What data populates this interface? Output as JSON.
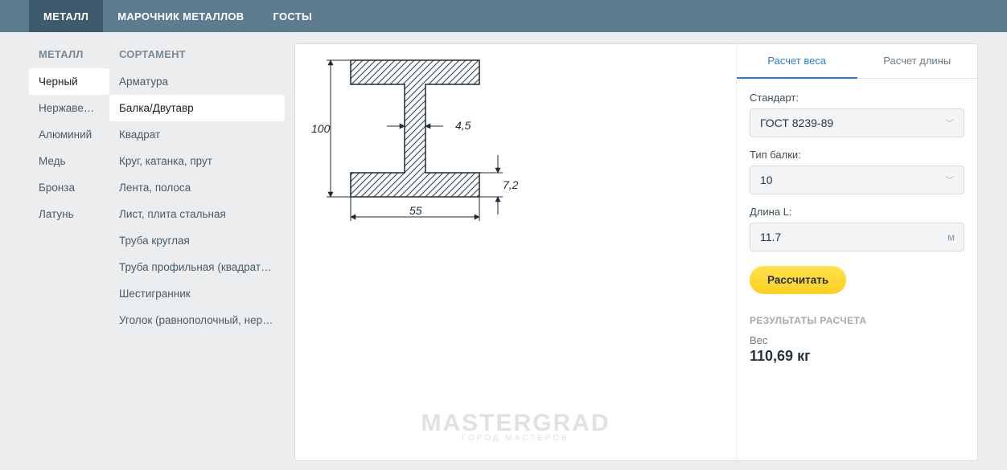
{
  "topNav": {
    "items": [
      {
        "label": "МЕТАЛЛ",
        "active": true
      },
      {
        "label": "МАРОЧНИК МЕТАЛЛОВ",
        "active": false
      },
      {
        "label": "ГОСТЫ",
        "active": false
      }
    ]
  },
  "sidebarMetal": {
    "header": "МЕТАЛЛ",
    "items": [
      {
        "label": "Черный",
        "active": true
      },
      {
        "label": "Нержавейка"
      },
      {
        "label": "Алюминий"
      },
      {
        "label": "Медь"
      },
      {
        "label": "Бронза"
      },
      {
        "label": "Латунь"
      }
    ]
  },
  "sidebarSortament": {
    "header": "СОРТАМЕНТ",
    "items": [
      {
        "label": "Арматура"
      },
      {
        "label": "Балка/Двутавр",
        "active": true
      },
      {
        "label": "Квадрат"
      },
      {
        "label": "Круг, катанка, прут"
      },
      {
        "label": "Лента, полоса"
      },
      {
        "label": "Лист, плита стальная"
      },
      {
        "label": "Труба круглая"
      },
      {
        "label": "Труба профильная (квадратная /…"
      },
      {
        "label": "Шестигранник"
      },
      {
        "label": "Уголок (равнополочный, неравн…"
      }
    ]
  },
  "diagram": {
    "height": "100",
    "width": "55",
    "web": "4,5",
    "flange": "7,2"
  },
  "calc": {
    "tabs": [
      {
        "label": "Расчет веса",
        "active": true
      },
      {
        "label": "Расчет длины",
        "active": false
      }
    ],
    "standard": {
      "label": "Стандарт:",
      "value": "ГОСТ 8239-89"
    },
    "beamType": {
      "label": "Тип балки:",
      "value": "10"
    },
    "length": {
      "label": "Длина L:",
      "value": "11.7",
      "unit": "м"
    },
    "button": "Рассчитать",
    "resultsHeader": "РЕЗУЛЬТАТЫ РАСЧЕТА",
    "result": {
      "label": "Вес",
      "value": "110,69 кг"
    }
  },
  "watermark": {
    "main": "MASTERGRAD",
    "sub": "ГОРОД МАСТЕРОВ"
  }
}
